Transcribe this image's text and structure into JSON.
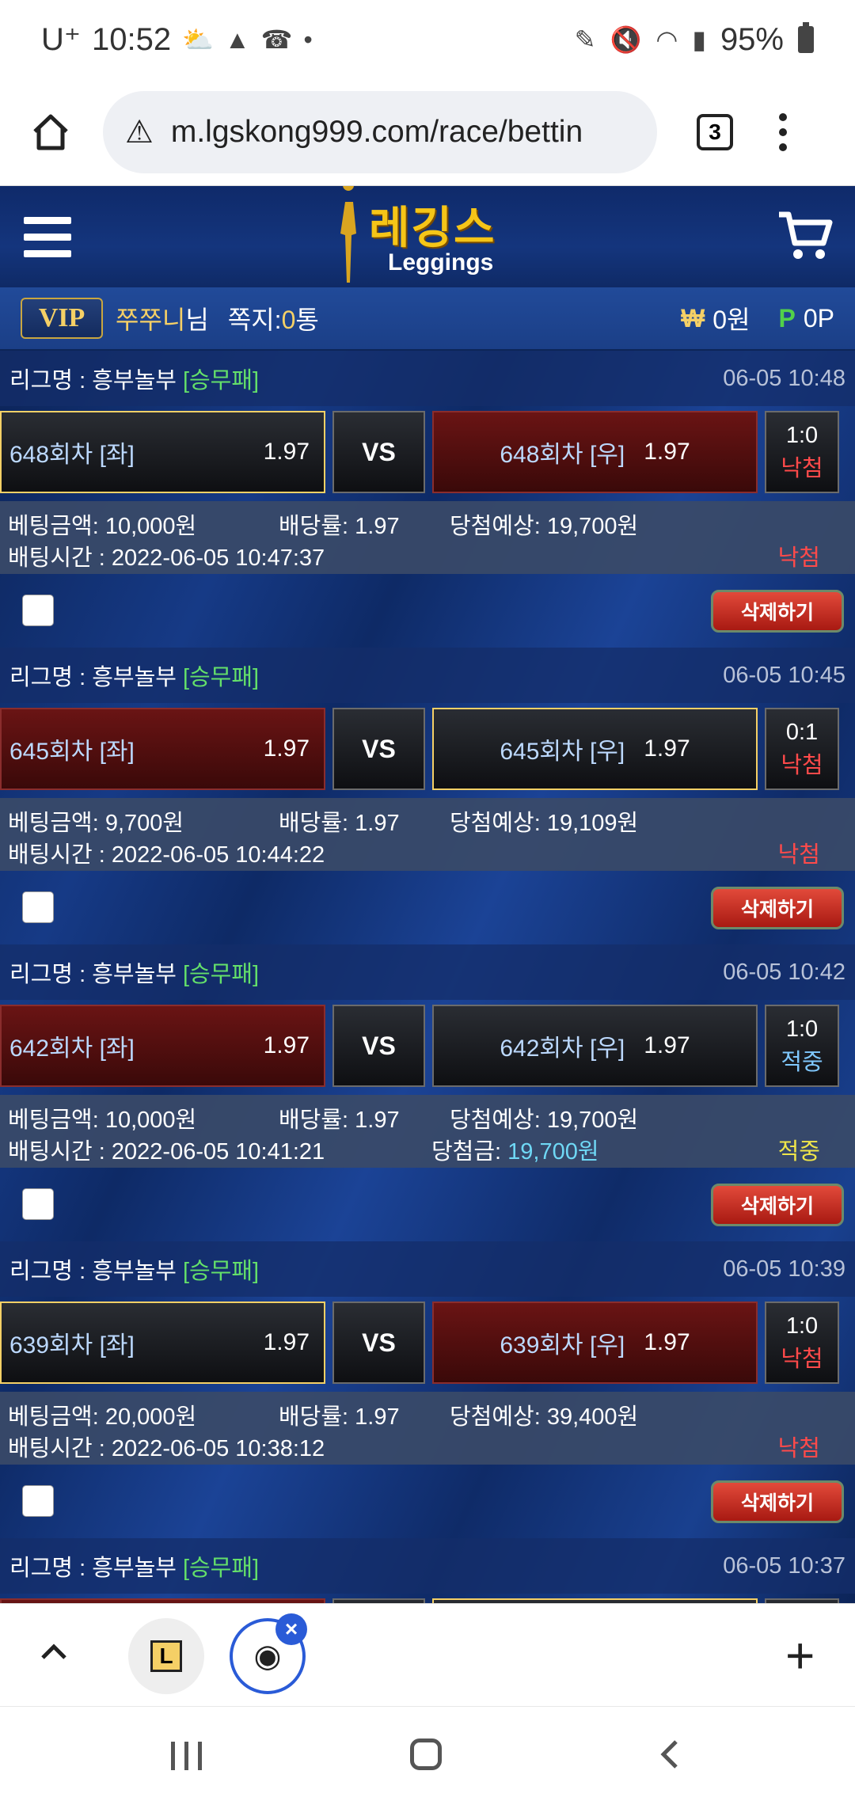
{
  "status_bar": {
    "carrier": "U⁺",
    "time": "10:52",
    "battery": "95%"
  },
  "browser": {
    "url": "m.lgskong999.com/race/bettin",
    "tab_count": "3"
  },
  "site": {
    "logo_kr": "레깅스",
    "logo_en": "Leggings"
  },
  "user": {
    "vip": "VIP",
    "name": "쭈쭈니",
    "name_suffix": "님",
    "messages_label": "쪽지:",
    "messages_count": "0",
    "messages_unit": "통",
    "won_symbol": "₩",
    "money": "0원",
    "points_symbol": "P",
    "points": "0P"
  },
  "labels": {
    "vs": "VS",
    "bet_amount": "베팅금액:",
    "odds": "배당률:",
    "expected": "당첨예상:",
    "bet_time": "배팅시간 :",
    "winnings": "당첨금:",
    "delete": "삭제하기"
  },
  "bets": [
    {
      "league": "리그명 : 흥부놀부",
      "type": "[승무패]",
      "date": "06-05 10:48",
      "left_team": "648회차 [좌]",
      "left_odds": "1.97",
      "right_team": "648회차 [우]",
      "right_odds": "1.97",
      "score": "1:0",
      "result": "낙첨",
      "amount": "10,000원",
      "odds": "1.97",
      "expected": "19,700원",
      "time": "2022-06-05 10:47:37",
      "status": "낙첨"
    },
    {
      "league": "리그명 : 흥부놀부",
      "type": "[승무패]",
      "date": "06-05 10:45",
      "left_team": "645회차 [좌]",
      "left_odds": "1.97",
      "right_team": "645회차 [우]",
      "right_odds": "1.97",
      "score": "0:1",
      "result": "낙첨",
      "amount": "9,700원",
      "odds": "1.97",
      "expected": "19,109원",
      "time": "2022-06-05 10:44:22",
      "status": "낙첨"
    },
    {
      "league": "리그명 : 흥부놀부",
      "type": "[승무패]",
      "date": "06-05 10:42",
      "left_team": "642회차 [좌]",
      "left_odds": "1.97",
      "right_team": "642회차 [우]",
      "right_odds": "1.97",
      "score": "1:0",
      "result": "적중",
      "amount": "10,000원",
      "odds": "1.97",
      "expected": "19,700원",
      "time": "2022-06-05 10:41:21",
      "winnings": "19,700원",
      "status": "적중"
    },
    {
      "league": "리그명 : 흥부놀부",
      "type": "[승무패]",
      "date": "06-05 10:39",
      "left_team": "639회차 [좌]",
      "left_odds": "1.97",
      "right_team": "639회차 [우]",
      "right_odds": "1.97",
      "score": "1:0",
      "result": "낙첨",
      "amount": "20,000원",
      "odds": "1.97",
      "expected": "39,400원",
      "time": "2022-06-05 10:38:12",
      "status": "낙첨"
    },
    {
      "league": "리그명 : 흥부놀부",
      "type": "[승무패]",
      "date": "06-05 10:37"
    }
  ],
  "colors": {
    "header_bg": "#14357d",
    "lose": "#ff4a4a",
    "win": "#f0e64a",
    "type_green": "#64e06a"
  }
}
